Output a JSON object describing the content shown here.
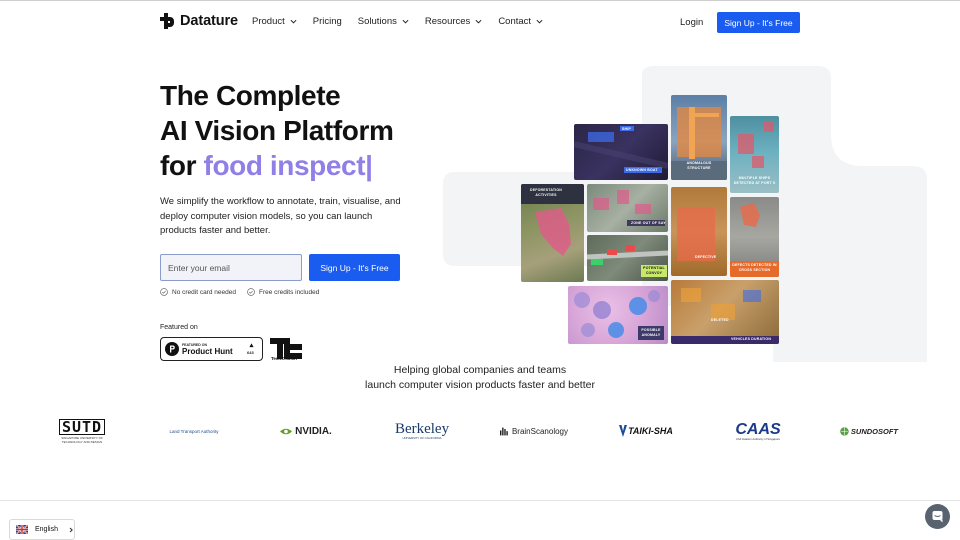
{
  "brand": {
    "name": "Datature",
    "accent": "#1a5cf0",
    "highlight": "#8f7fe6"
  },
  "nav": {
    "items": [
      {
        "label": "Product",
        "has_dropdown": true
      },
      {
        "label": "Pricing",
        "has_dropdown": false
      },
      {
        "label": "Solutions",
        "has_dropdown": true
      },
      {
        "label": "Resources",
        "has_dropdown": true
      },
      {
        "label": "Contact",
        "has_dropdown": true
      }
    ],
    "login": "Login",
    "signup": "Sign Up - It's Free"
  },
  "hero": {
    "title_line1": "The Complete",
    "title_line2": "AI Vision Platform",
    "title_line3_prefix": "for ",
    "title_line3_typed": "food inspect|",
    "description": "We simplify the workflow to annotate, train, visualise, and deploy computer vision models, so you can launch products faster and better.",
    "email_placeholder": "Enter your email",
    "signup": "Sign Up - It's Free",
    "perks": [
      "No credit card needed",
      "Free credits included"
    ],
    "featured_label": "Featured on",
    "product_hunt": {
      "small": "FEATURED ON",
      "name": "Product Hunt",
      "count": "643"
    },
    "techcrunch": "TechCrunch"
  },
  "mosaic": {
    "labels": {
      "ship": "SHIP",
      "unknown_boat": "UNKNOWN BOAT",
      "anomalous_structure": "ANOMALOUS STRUCTURE",
      "multiple_ships": "MULTIPLE SHIPS DETECTED AT PORT 5",
      "deforestation": "DEFORESTATION ACTIVITIES",
      "zone_out": "ZONE OUT OF SAY",
      "defective": "DEFECTIVE",
      "defects_detected": "DEFECTS DETECTED IN CROSS SECTION",
      "potential_convoy": "POTENTIAL CONVOY",
      "possible_anomaly": "POSSIBLE ANOMALY",
      "deleted": "DELETED",
      "vehicles_duration": "VEHICLES DURATION"
    }
  },
  "customers": {
    "line1": "Helping global companies and teams",
    "line2": "launch computer vision products faster and better",
    "logos": [
      {
        "name": "SUTD",
        "sub": "SINGAPORE UNIVERSITY OF TECHNOLOGY AND DESIGN"
      },
      {
        "name": "Land Transport Authority"
      },
      {
        "name": "NVIDIA."
      },
      {
        "name": "Berkeley",
        "sub": "UNIVERSITY OF CALIFORNIA"
      },
      {
        "name": "BrainScanology"
      },
      {
        "name": "TAIKI-SHA"
      },
      {
        "name": "CAAS",
        "sub": "Civil Aviation Authority of Singapore"
      },
      {
        "name": "SUNDOSOFT"
      }
    ]
  },
  "footer": {
    "language": "English"
  }
}
